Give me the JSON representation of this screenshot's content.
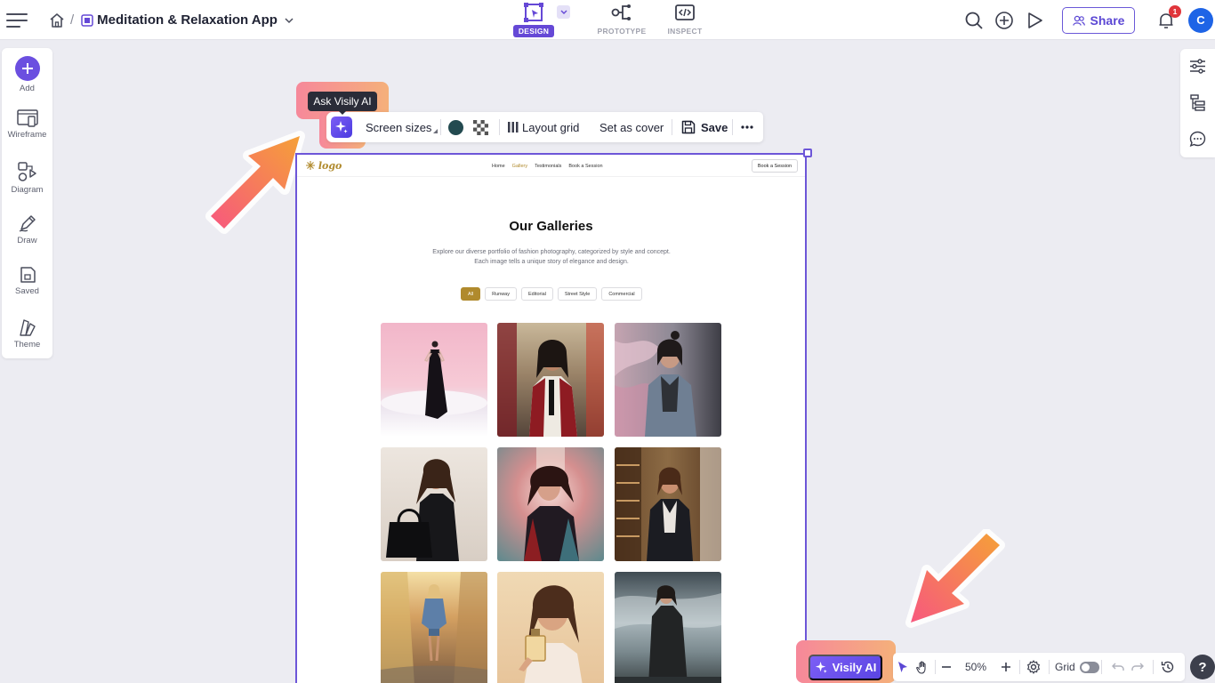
{
  "header": {
    "project_title": "Meditation & Relaxation App",
    "breadcrumb_separator": "/",
    "modes": [
      {
        "label": "DESIGN",
        "icon": "design-icon",
        "active": true
      },
      {
        "label": "PROTOTYPE",
        "icon": "prototype-icon",
        "active": false
      },
      {
        "label": "INSPECT",
        "icon": "code-icon",
        "active": false
      }
    ],
    "share_label": "Share",
    "notification_count": "1",
    "avatar_initial": "C"
  },
  "left_tools": [
    {
      "label": "Add",
      "icon": "plus-icon"
    },
    {
      "label": "Wireframe",
      "icon": "wireframe-icon"
    },
    {
      "label": "Diagram",
      "icon": "diagram-icon"
    },
    {
      "label": "Draw",
      "icon": "pen-icon"
    },
    {
      "label": "Saved",
      "icon": "save-icon"
    },
    {
      "label": "Theme",
      "icon": "theme-icon"
    }
  ],
  "toolbar": {
    "ai_tooltip": "Ask Visily AI",
    "screen_sizes": "Screen sizes",
    "layout_grid": "Layout grid",
    "set_as_cover": "Set as cover",
    "save": "Save",
    "fill_color": "#234a50"
  },
  "frame": {
    "logo": "logo",
    "nav_links": [
      "Home",
      "Gallery",
      "Testimonials",
      "Book a Session"
    ],
    "active_nav": "Gallery",
    "book_button": "Book a Session",
    "title": "Our Galleries",
    "description": "Explore our diverse portfolio of fashion photography, categorized by style and concept. Each image tells a unique story of elegance and design.",
    "filters": [
      "All",
      "Runway",
      "Editorial",
      "Street Style",
      "Commercial"
    ],
    "active_filter": "All",
    "accent": "#b08a2d"
  },
  "bottom": {
    "ai_button": "Visily AI",
    "zoom": "50%",
    "grid_label": "Grid",
    "help": "?"
  }
}
